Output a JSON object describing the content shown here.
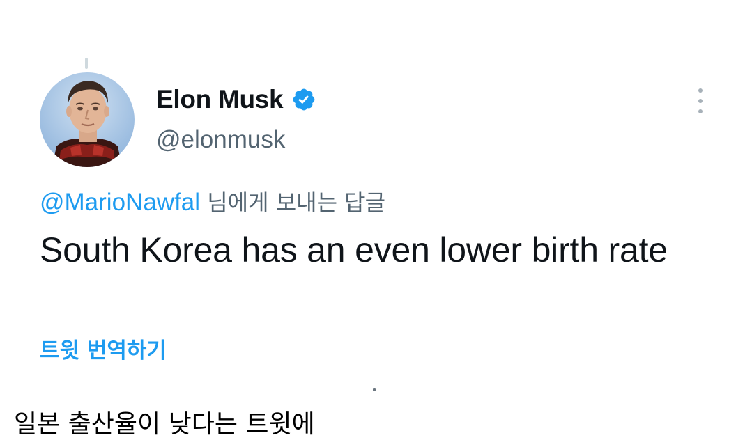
{
  "tweet": {
    "author": {
      "display_name": "Elon Musk",
      "handle": "@elonmusk",
      "verified": true
    },
    "reply_to": {
      "mention": "@MarioNawfal",
      "suffix": " 님에게 보내는 답글"
    },
    "text": "South Korea has an even lower birth rate",
    "translate_label": "트윗 번역하기"
  },
  "caption": "일본 출산율이 낮다는 트윗에",
  "colors": {
    "accent": "#1d9bf0",
    "secondary_text": "#536471",
    "primary_text": "#0f1419"
  },
  "icons": {
    "verified": "verified-badge-icon",
    "more": "more-vertical-icon"
  }
}
